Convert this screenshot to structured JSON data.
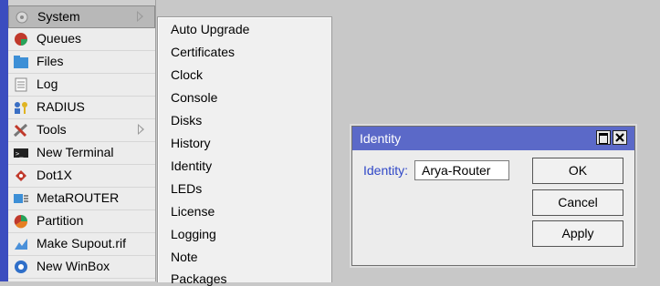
{
  "main_menu": {
    "items": [
      {
        "label": "System",
        "icon": "system-icon",
        "has_submenu": true,
        "selected": true
      },
      {
        "label": "Queues",
        "icon": "queues-icon"
      },
      {
        "label": "Files",
        "icon": "files-icon"
      },
      {
        "label": "Log",
        "icon": "log-icon"
      },
      {
        "label": "RADIUS",
        "icon": "radius-icon"
      },
      {
        "label": "Tools",
        "icon": "tools-icon",
        "has_submenu": true
      },
      {
        "label": "New Terminal",
        "icon": "terminal-icon"
      },
      {
        "label": "Dot1X",
        "icon": "dot1x-icon"
      },
      {
        "label": "MetaROUTER",
        "icon": "metarouter-icon"
      },
      {
        "label": "Partition",
        "icon": "partition-icon"
      },
      {
        "label": "Make Supout.rif",
        "icon": "supout-icon"
      },
      {
        "label": "New WinBox",
        "icon": "winbox-icon"
      }
    ]
  },
  "system_submenu": {
    "items": [
      "Auto Upgrade",
      "Certificates",
      "Clock",
      "Console",
      "Disks",
      "History",
      "Identity",
      "LEDs",
      "License",
      "Logging",
      "Note",
      "Packages"
    ]
  },
  "identity_dialog": {
    "title": "Identity",
    "field_label": "Identity:",
    "field_value": "Arya-Router",
    "ok_label": "OK",
    "cancel_label": "Cancel",
    "apply_label": "Apply"
  },
  "colors": {
    "title_bar": "#5b69c8",
    "label_blue": "#2f47c7",
    "left_strip": "#3b4dbf"
  }
}
